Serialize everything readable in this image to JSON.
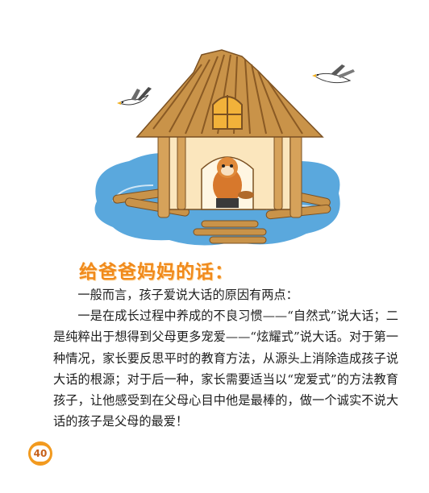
{
  "illustration": {
    "subject": "wooden-house-on-water-with-beaver",
    "colors": {
      "water": "#5aa8dd",
      "wood": "#c99349",
      "wall": "#fbe6bd",
      "window": "#f2b23a"
    }
  },
  "heading": "给爸爸妈妈的话：",
  "paragraphs": [
    "一般而言，孩子爱说大话的原因有两点：",
    "一是在成长过程中养成的不良习惯——“自然式”说大话；二是纯粹出于想得到父母更多宠爱——“炫耀式”说大话。对于第一种情况，家长要反思平时的教育方法，从源头上消除造成孩子说大话的根源；对于后一种，家长需要适当以“宠爱式”的方法教育孩子，让他感受到在父母心目中他是最棒的，做一个诚实不说大话的孩子是父母的最爱！"
  ],
  "page_number": "40",
  "accent_color": "#f08a1c"
}
